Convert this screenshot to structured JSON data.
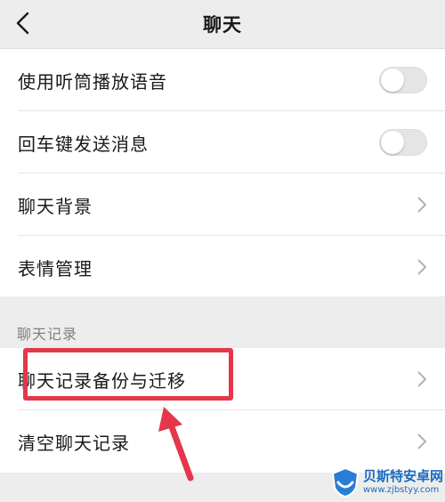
{
  "header": {
    "title": "聊天"
  },
  "settings": {
    "items": [
      {
        "label": "使用听筒播放语音",
        "control": "toggle",
        "on": false
      },
      {
        "label": "回车键发送消息",
        "control": "toggle",
        "on": false
      },
      {
        "label": "聊天背景",
        "control": "chevron"
      },
      {
        "label": "表情管理",
        "control": "chevron"
      }
    ]
  },
  "chat_records": {
    "section_label": "聊天记录",
    "items": [
      {
        "label": "聊天记录备份与迁移",
        "control": "chevron"
      },
      {
        "label": "清空聊天记录",
        "control": "chevron"
      }
    ]
  },
  "annotation": {
    "highlight_color": "#e5374a"
  },
  "watermark": {
    "name": "贝斯特安卓网",
    "url": "www.zjbstyy.com"
  },
  "colors": {
    "background": "#ededed",
    "toggle_off": "#e5e5e5",
    "chevron": "#b2b2b2"
  }
}
